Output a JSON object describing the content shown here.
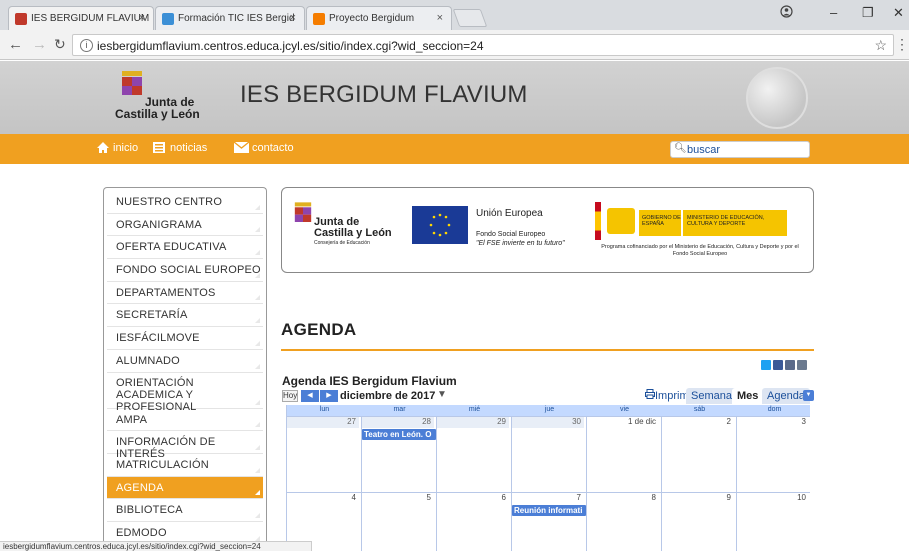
{
  "browser": {
    "tabs": [
      {
        "title": "IES BERGIDUM FLAVIUM",
        "close": "×",
        "favicon_color": "#c0392b"
      },
      {
        "title": "Formación TIC IES Bergid",
        "close": "×",
        "favicon_color": "#3b8fd6"
      },
      {
        "title": "Proyecto Bergidum",
        "close": "×",
        "favicon_color": "#f57d00"
      }
    ],
    "url": "iesbergidumflavium.centros.educa.jcyl.es/sitio/index.cgi?wid_seccion=24",
    "status_url": "iesbergidumflavium.centros.educa.jcyl.es/sitio/index.cgi?wid_seccion=24"
  },
  "header": {
    "logo_line1": "Junta de",
    "logo_line2": "Castilla y León",
    "site_title": "IES BERGIDUM FLAVIUM"
  },
  "topnav": {
    "items": [
      "inicio",
      "noticias",
      "contacto"
    ],
    "search_placeholder": "buscar",
    "accent_color": "#f0a020"
  },
  "sidebar": {
    "items": [
      "NUESTRO CENTRO",
      "ORGANIGRAMA",
      "OFERTA EDUCATIVA",
      "FONDO SOCIAL EUROPEO",
      "DEPARTAMENTOS",
      "SECRETARÍA",
      "IESFÁCILMOVE",
      "ALUMNADO",
      "ORIENTACIÓN ACADEMICA Y PROFESIONAL",
      "AMPA",
      "INFORMACIÓN DE INTERÉS",
      "MATRICULACIÓN",
      "AGENDA",
      "BIBLIOTECA",
      "EDMODO"
    ],
    "active": "AGENDA"
  },
  "banner": {
    "jcl_line1": "Junta de",
    "jcl_line2": "Castilla y León",
    "jcl_sub": "Consejería de Educación",
    "eu_title": "Unión Europea",
    "eu_fund": "Fondo Social Europeo",
    "eu_motto": "\"El FSE invierte en tu futuro\"",
    "gob_left": "GOBIERNO DE ESPAÑA",
    "gob_right": "MINISTERIO DE EDUCACIÓN, CULTURA Y DEPORTE",
    "gob_note": "Programa cofinanciado por el Ministerio de Educación, Cultura y Deporte y por el Fondo Social Europeo"
  },
  "agenda": {
    "heading": "AGENDA",
    "calendar_title": "Agenda IES Bergidum Flavium",
    "today_btn": "Hoy",
    "prev": "◀",
    "next": "▶",
    "month_label": "diciembre de 2017",
    "month_dropdown": "▼",
    "print_label": "Imprimir",
    "views": [
      "Semana",
      "Mes",
      "Agenda"
    ],
    "view_dropdown": "▼",
    "weekdays": [
      "lun",
      "mar",
      "mié",
      "jue",
      "vie",
      "sáb",
      "dom"
    ],
    "weeks": [
      [
        "27",
        "28",
        "29",
        "30",
        "1 de dic",
        "2",
        "3"
      ],
      [
        "4",
        "5",
        "6",
        "7",
        "8",
        "9",
        "10"
      ]
    ],
    "events": [
      {
        "week": 0,
        "day": 1,
        "title": "Teatro en León. O"
      },
      {
        "week": 1,
        "day": 3,
        "title": "Reunión informati"
      }
    ],
    "share_icons": [
      "twitter-icon",
      "facebook-icon",
      "email-icon",
      "print-icon"
    ]
  }
}
